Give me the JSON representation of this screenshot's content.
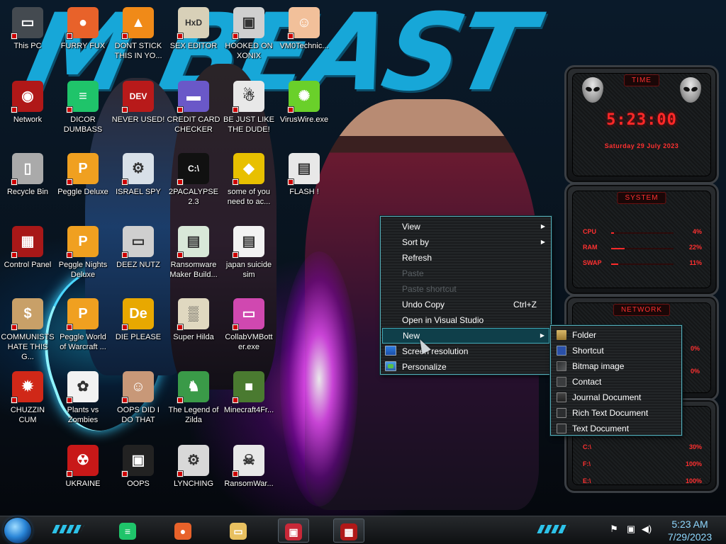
{
  "desktop_icons": [
    {
      "label": "This PC",
      "icon": "computer-icon",
      "color": "#444a50",
      "glyph": "▭"
    },
    {
      "label": "FURRY FUX",
      "icon": "firefox-icon",
      "color": "#e8622a",
      "glyph": "●"
    },
    {
      "label": "DONT STICK THIS IN YO...",
      "icon": "vlc-cone-icon",
      "color": "#f08a18",
      "glyph": "▲"
    },
    {
      "label": "SEX EDITOR",
      "icon": "hex-editor-icon",
      "color": "#d8d0b8",
      "glyph": "HxD"
    },
    {
      "label": "HOOKED ON XONIX",
      "icon": "xonix-game-icon",
      "color": "#cfcfcf",
      "glyph": "▣"
    },
    {
      "label": "VM0Technic...",
      "icon": "doctor-person-icon",
      "color": "#f2c09a",
      "glyph": "☺"
    },
    {
      "label": "Network",
      "icon": "network-globe-icon",
      "color": "#b01818",
      "glyph": "◉"
    },
    {
      "label": "DICOR DUMBASS",
      "icon": "chat-bubble-icon",
      "color": "#1fc46a",
      "glyph": "≡"
    },
    {
      "label": "NEVER USED!",
      "icon": "dev-cpp-icon",
      "color": "#b81a1a",
      "glyph": "DEV"
    },
    {
      "label": "CREDIT CARD CHECKER",
      "icon": "credit-card-icon",
      "color": "#6a58c8",
      "glyph": "▬"
    },
    {
      "label": "BE JUST LIKE THE DUDE!",
      "icon": "santa-icon",
      "color": "#e8e8e8",
      "glyph": "☃"
    },
    {
      "label": "VirusWire.exe",
      "icon": "lime-icon",
      "color": "#6ad02a",
      "glyph": "✺"
    },
    {
      "label": "Recycle Bin",
      "icon": "recycle-bin-icon",
      "color": "#aaaaaa",
      "glyph": "▯"
    },
    {
      "label": "Peggle Deluxe",
      "icon": "peggle-icon",
      "color": "#f0a020",
      "glyph": "P"
    },
    {
      "label": "ISRAEL SPY",
      "icon": "spy-tool-icon",
      "color": "#d8e0e8",
      "glyph": "⚙"
    },
    {
      "label": "2PACALYPSE 2.3",
      "icon": "terminal-icon",
      "color": "#111111",
      "glyph": "C:\\"
    },
    {
      "label": "some of you need to ac...",
      "icon": "beaver-icon",
      "color": "#e8c000",
      "glyph": "◆"
    },
    {
      "label": "FLASH !",
      "icon": "flash-file-icon",
      "color": "#e8e8e8",
      "glyph": "▤"
    },
    {
      "label": "Control Panel",
      "icon": "control-panel-icon",
      "color": "#a81818",
      "glyph": "▦"
    },
    {
      "label": "Peggle Nights Deluxe",
      "icon": "peggle-nights-icon",
      "color": "#f0a020",
      "glyph": "P"
    },
    {
      "label": "DEEZ NUTZ",
      "icon": "windows-stack-icon",
      "color": "#cfcfcf",
      "glyph": "▭"
    },
    {
      "label": "Ransomware Maker Build...",
      "icon": "app-window-icon",
      "color": "#d8e8d8",
      "glyph": "▤"
    },
    {
      "label": "japan suicide sim",
      "icon": "document-icon",
      "color": "#f2f2f2",
      "glyph": "▤"
    },
    {
      "label": "",
      "icon": "",
      "color": "",
      "glyph": ""
    },
    {
      "label": "COMMUNISTS HATE THIS G...",
      "icon": "money-bag-icon",
      "color": "#c8a068",
      "glyph": "$"
    },
    {
      "label": "Peggle World of Warcraft ...",
      "icon": "peggle-wow-icon",
      "color": "#f0a020",
      "glyph": "P"
    },
    {
      "label": "DIE PLEASE",
      "icon": "dev-c-icon",
      "color": "#e8a800",
      "glyph": "De"
    },
    {
      "label": "Super Hilda",
      "icon": "pixel-game-icon",
      "color": "#e0d8c0",
      "glyph": "▒"
    },
    {
      "label": "CollabVMBott er.exe",
      "icon": "monitor-app-icon",
      "color": "#d048b0",
      "glyph": "▭"
    },
    {
      "label": "",
      "icon": "",
      "color": "",
      "glyph": ""
    },
    {
      "label": "CHUZZIN CUM",
      "icon": "chuzzle-icon",
      "color": "#d02818",
      "glyph": "✹"
    },
    {
      "label": "Plants vs Zombies",
      "icon": "plants-zombies-icon",
      "color": "#f2f2f2",
      "glyph": "✿"
    },
    {
      "label": "OOPS DID I DO THAT",
      "icon": "portrait-painting-icon",
      "color": "#c89878",
      "glyph": "☺"
    },
    {
      "label": "The Legend of Zilda",
      "icon": "pixel-hero-icon",
      "color": "#3a9a48",
      "glyph": "♞"
    },
    {
      "label": "Minecraft4Fr...",
      "icon": "grass-block-icon",
      "color": "#4a7a30",
      "glyph": "■"
    },
    {
      "label": "",
      "icon": "",
      "color": "",
      "glyph": ""
    },
    {
      "label": "",
      "icon": "",
      "color": "",
      "glyph": ""
    },
    {
      "label": "UKRAINE",
      "icon": "radiation-icon",
      "color": "#c81818",
      "glyph": "☢"
    },
    {
      "label": "OOPS",
      "icon": "dark-app-icon",
      "color": "#222222",
      "glyph": "▣"
    },
    {
      "label": "LYNCHING",
      "icon": "network-knot-icon",
      "color": "#d8d8d8",
      "glyph": "⚙"
    },
    {
      "label": "RansomWar...",
      "icon": "skull-icon",
      "color": "#e8e8e8",
      "glyph": "☠"
    },
    {
      "label": "",
      "icon": "",
      "color": "",
      "glyph": ""
    }
  ],
  "gadgets": {
    "clock": {
      "title": "TIME",
      "time": "5:23:00",
      "date": "Saturday 29 July 2023"
    },
    "system": {
      "title": "SYSTEM",
      "rows": [
        {
          "label": "CPU",
          "value": "4%",
          "fraction": 0.04
        },
        {
          "label": "RAM",
          "value": "22%",
          "fraction": 0.22
        },
        {
          "label": "SWAP",
          "value": "11%",
          "fraction": 0.11
        }
      ]
    },
    "network": {
      "title": "NETWORK",
      "values": [
        "0%",
        "0%"
      ]
    },
    "drives": {
      "rows": [
        {
          "label": "C:\\",
          "value": "30%"
        },
        {
          "label": "F:\\",
          "value": "100%"
        },
        {
          "label": "E:\\",
          "value": "100%"
        }
      ]
    }
  },
  "context_menu": {
    "items": [
      {
        "label": "View",
        "submenu": true
      },
      {
        "label": "Sort by",
        "submenu": true
      },
      {
        "label": "Refresh"
      },
      {
        "label": "Paste",
        "disabled": true
      },
      {
        "label": "Paste shortcut",
        "disabled": true
      },
      {
        "label": "Undo Copy",
        "shortcut": "Ctrl+Z"
      },
      {
        "label": "Open in Visual Studio"
      },
      {
        "label": "New",
        "submenu": true,
        "selected": true
      },
      {
        "label": "Screen resolution",
        "icon": "screen-resolution-icon"
      },
      {
        "label": "Personalize",
        "icon": "personalize-icon"
      }
    ]
  },
  "new_submenu": {
    "items": [
      {
        "label": "Folder",
        "icon": "folder-icon"
      },
      {
        "label": "Shortcut",
        "icon": "shortcut-icon"
      },
      {
        "label": "Bitmap image",
        "icon": "bitmap-icon"
      },
      {
        "label": "Contact",
        "icon": "contact-icon"
      },
      {
        "label": "Journal Document",
        "icon": "journal-icon"
      },
      {
        "label": "Rich Text Document",
        "icon": "rich-text-icon"
      },
      {
        "label": "Text Document",
        "icon": "text-document-icon"
      }
    ]
  },
  "taskbar": {
    "pinned": [
      {
        "name": "chat-app-icon",
        "color": "#1fc46a",
        "glyph": "≡"
      },
      {
        "name": "firefox-icon",
        "color": "#e8622a",
        "glyph": "●"
      },
      {
        "name": "file-explorer-icon",
        "color": "#e8c060",
        "glyph": "▭"
      },
      {
        "name": "media-app-icon",
        "color": "#c82838",
        "glyph": "▣"
      },
      {
        "name": "control-panel-icon",
        "color": "#b01818",
        "glyph": "▦"
      }
    ],
    "clock": {
      "time": "5:23 AM",
      "date": "7/29/2023"
    }
  },
  "colors": {
    "accent": "#59aeb9",
    "gadget_red": "#ff2828",
    "clock_blue": "#8fd8ff"
  }
}
